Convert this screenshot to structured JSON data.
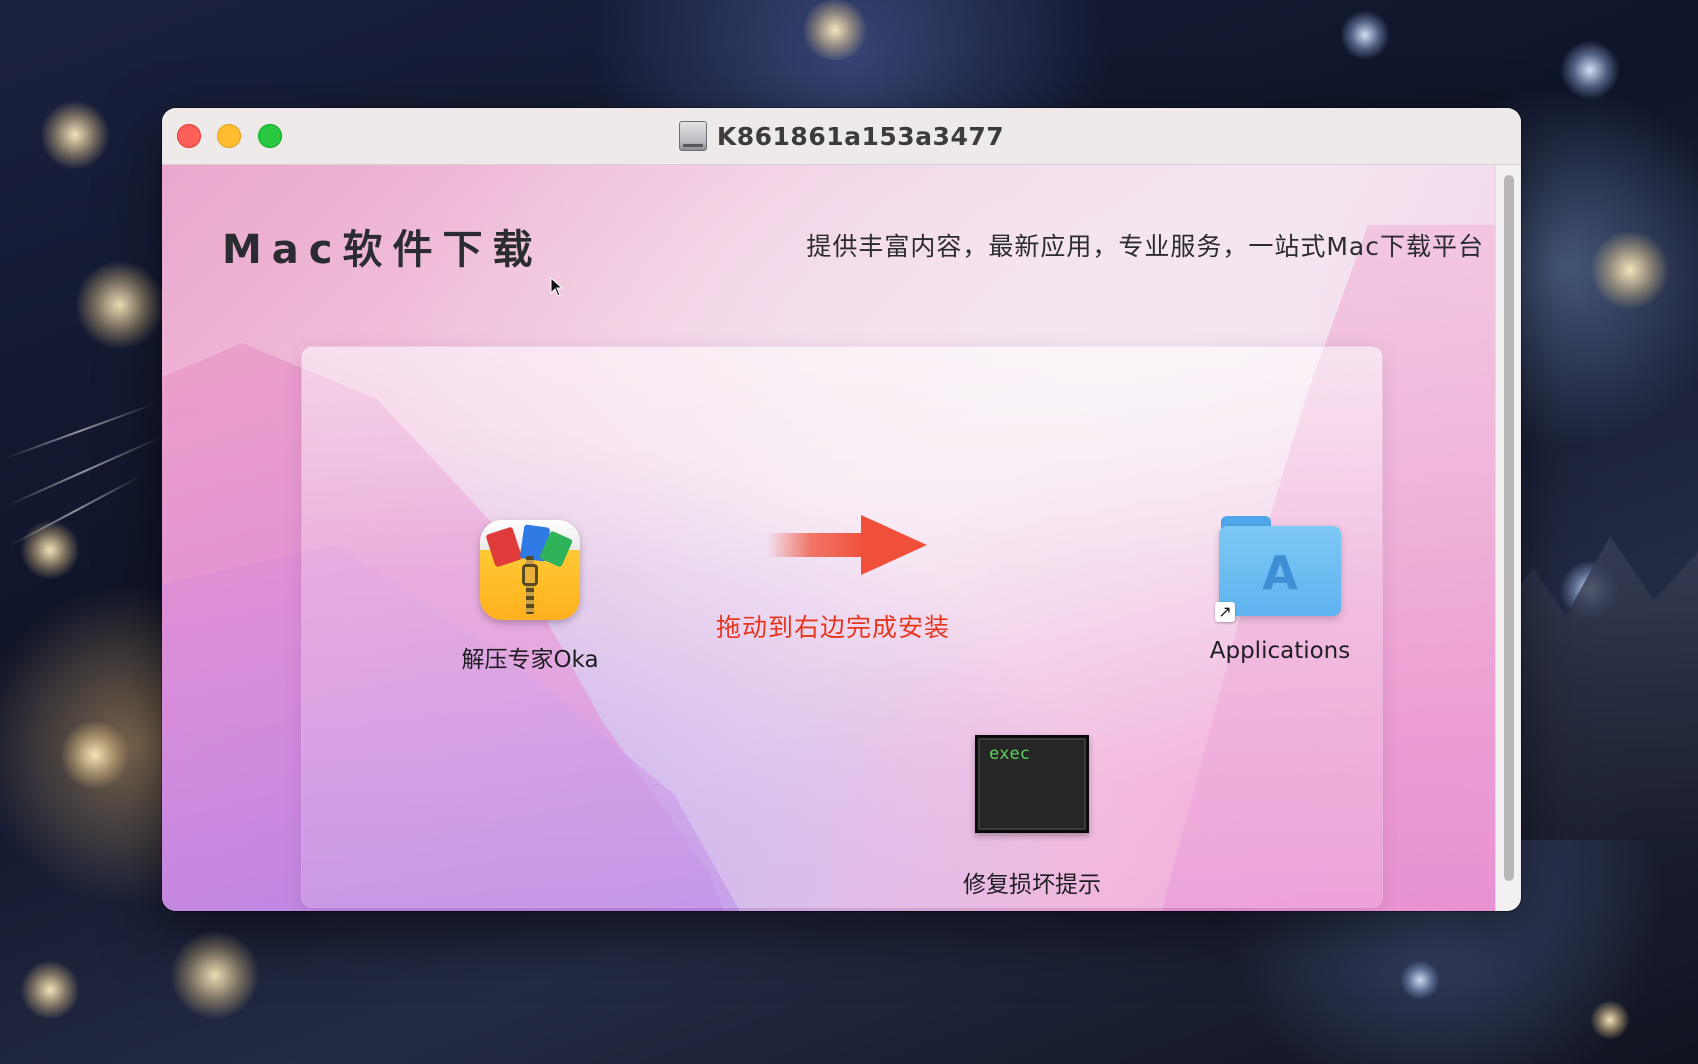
{
  "window": {
    "title": "K861861a153a3477",
    "title_icon": "disk-image-icon"
  },
  "header": {
    "brand_title": "Mac软件下载",
    "slogan": "提供丰富内容，最新应用，专业服务，一站式Mac下载平台"
  },
  "installer": {
    "app": {
      "label": "解压专家Oka",
      "icon": "archive-app-icon"
    },
    "hint": "拖动到右边完成安装",
    "hint_color": "#e8361e",
    "applications": {
      "label": "Applications",
      "icon": "applications-folder-icon"
    },
    "fix_tool": {
      "label": "修复损坏提示",
      "icon_text": "exec",
      "icon": "exec-terminal-icon"
    }
  },
  "colors": {
    "close": "#fe5f57",
    "minimize": "#febc2e",
    "zoom": "#28c840",
    "arrow": "#f0503a"
  }
}
